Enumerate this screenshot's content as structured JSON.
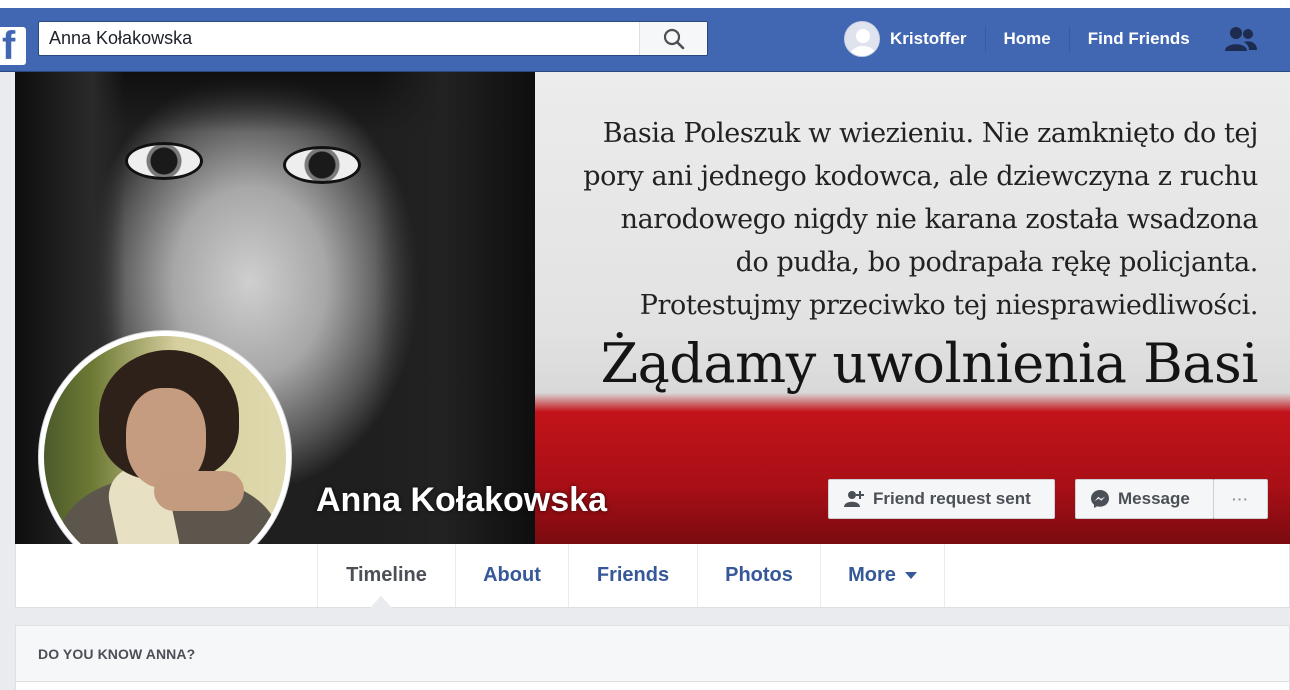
{
  "header": {
    "logo": "f",
    "search_value": "Anna Kołakowska",
    "user_name": "Kristoffer",
    "nav_home": "Home",
    "nav_find_friends": "Find Friends",
    "brand_color": "#4267b2"
  },
  "cover": {
    "text_lines": [
      "Basia Poleszuk w wiezieniu. Nie zamknięto do tej",
      "pory ani jednego kodowca, ale dziewczyna z ruchu",
      "narodowego nigdy nie karana została wsadzona",
      "do pudła, bo podrapała rękę policjanta.",
      "Protestujmy przeciwko tej niesprawiedliwości."
    ],
    "headline": "Żądamy uwolnienia Basi"
  },
  "profile": {
    "name": "Anna Kołakowska",
    "friend_request_label": "Friend request sent",
    "message_label": "Message",
    "more_label": "···"
  },
  "tabs": [
    {
      "label": "Timeline",
      "active": true
    },
    {
      "label": "About"
    },
    {
      "label": "Friends"
    },
    {
      "label": "Photos"
    },
    {
      "label": "More"
    }
  ],
  "know_card": {
    "title": "DO YOU KNOW ANNA?"
  }
}
